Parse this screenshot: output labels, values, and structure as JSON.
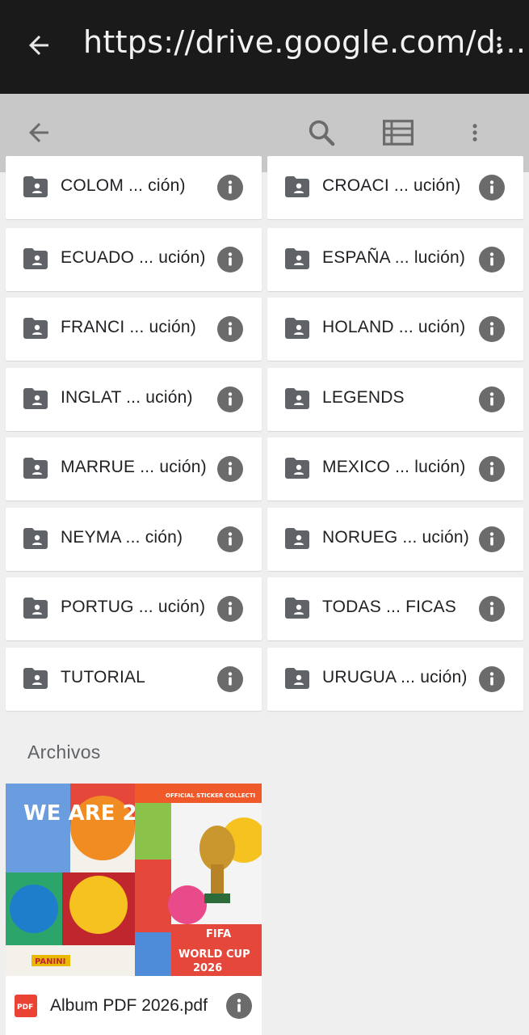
{
  "browser": {
    "url": "https://drive.google.com/d..."
  },
  "folders": [
    {
      "name": "COLOM ... ción)"
    },
    {
      "name": "CROACI ... ución)"
    },
    {
      "name": "ECUADO ... ución)"
    },
    {
      "name": "ESPAÑA ... lución)"
    },
    {
      "name": "FRANCI ... ución)"
    },
    {
      "name": "HOLAND ... ución)"
    },
    {
      "name": "INGLAT ... ución)"
    },
    {
      "name": "LEGENDS"
    },
    {
      "name": "MARRUE ... ución)"
    },
    {
      "name": "MEXICO ... lución)"
    },
    {
      "name": "NEYMA ... ción)"
    },
    {
      "name": "NORUEG ... ución)"
    },
    {
      "name": "PORTUG ... ución)"
    },
    {
      "name": "TODAS ... FICAS"
    },
    {
      "name": "TUTORIAL"
    },
    {
      "name": "URUGUA ... ución)"
    }
  ],
  "files_section": {
    "title": "Archivos"
  },
  "files": [
    {
      "name": "Album PDF 2026.pdf",
      "pdf_badge": "PDF",
      "thumbnail": {
        "left_art_text": "WE ARE 26",
        "banner": "OFFICIAL STICKER COLLECTI",
        "logo_text": "FIFA",
        "title_line1": "WORLD CUP",
        "title_line2": "2026",
        "brand": "PANINI"
      }
    }
  ],
  "colors": {
    "topbar": "#1a1a1a",
    "toolbar": "#c8c8c8",
    "background": "#efefef",
    "icon_gray": "#6b6b6b",
    "pdf_red": "#ea4335"
  }
}
